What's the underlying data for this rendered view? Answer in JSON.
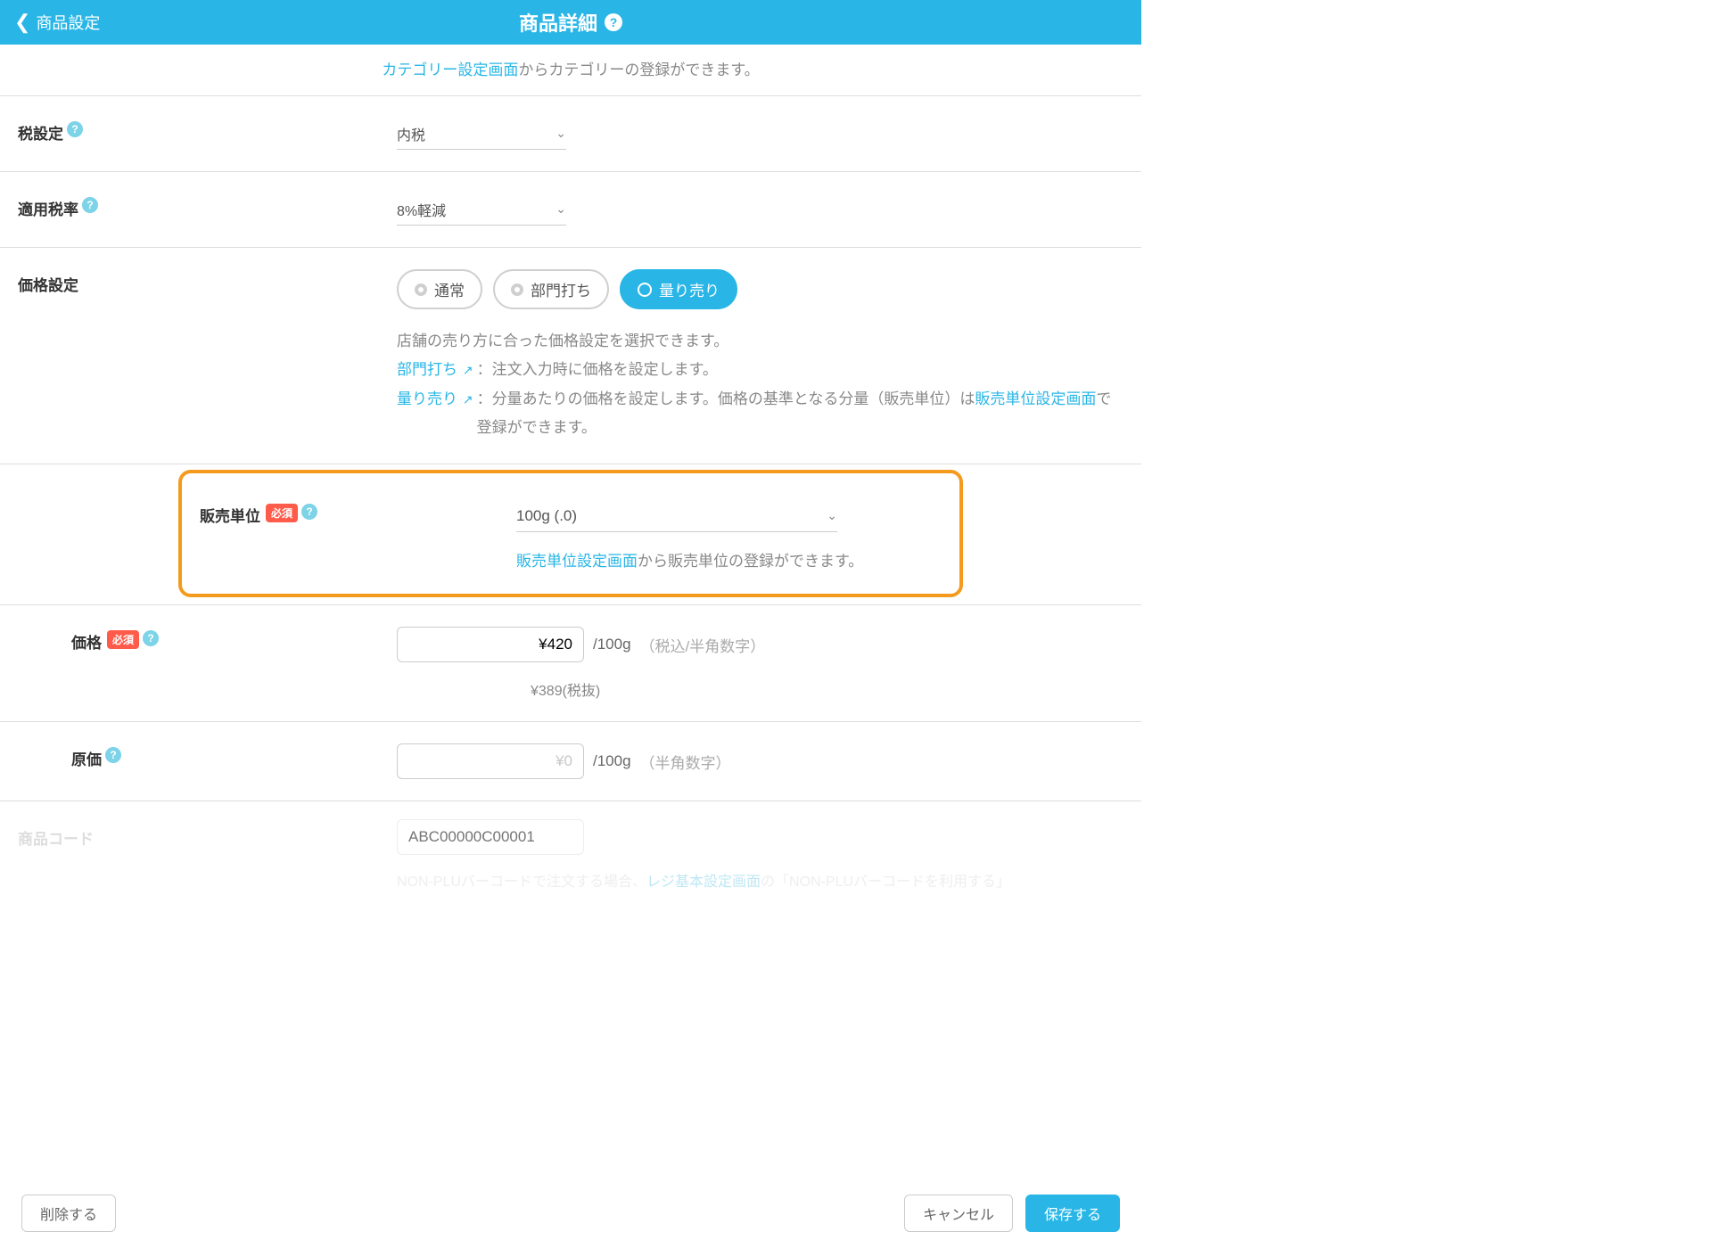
{
  "header": {
    "back_label": "商品設定",
    "title": "商品詳細"
  },
  "category_hint": {
    "link": "カテゴリー設定画面",
    "rest": "からカテゴリーの登録ができます。"
  },
  "tax": {
    "label": "税設定",
    "value": "内税"
  },
  "tax_rate": {
    "label": "適用税率",
    "value": "8%軽減"
  },
  "price_setting": {
    "label": "価格設定",
    "options": {
      "normal": "通常",
      "dept": "部門打ち",
      "weigh": "量り売り"
    },
    "desc_line1": "店舗の売り方に合った価格設定を選択できます。",
    "dept_link": "部門打ち",
    "dept_desc": "：注文入力時に価格を設定します。",
    "weigh_link": "量り売り",
    "weigh_desc_a": "：分量あたりの価格を設定します。価格の基準となる分量（販売単位）は",
    "weigh_desc_link": "販売単位設定画面",
    "weigh_desc_b": "で登録ができます。"
  },
  "sales_unit": {
    "label": "販売単位",
    "required": "必須",
    "value": "100g (.0)",
    "hint_link": "販売単位設定画面",
    "hint_rest": "から販売単位の登録ができます。"
  },
  "price": {
    "label": "価格",
    "required": "必須",
    "value": "¥420",
    "per": "/100g",
    "paren": "（税込/半角数字）",
    "sub": "¥389(税抜)"
  },
  "cost": {
    "label": "原価",
    "placeholder": "¥0",
    "per": "/100g",
    "paren": "（半角数字）"
  },
  "code": {
    "label": "商品コード",
    "placeholder": "ABC00000C00001",
    "desc_a": "NON-PLUバーコードで注文する場合、",
    "desc_link": "レジ基本設定画面",
    "desc_b": "の「NON-PLUバーコードを利用する」"
  },
  "footer": {
    "delete": "削除する",
    "cancel": "キャンセル",
    "save": "保存する"
  }
}
